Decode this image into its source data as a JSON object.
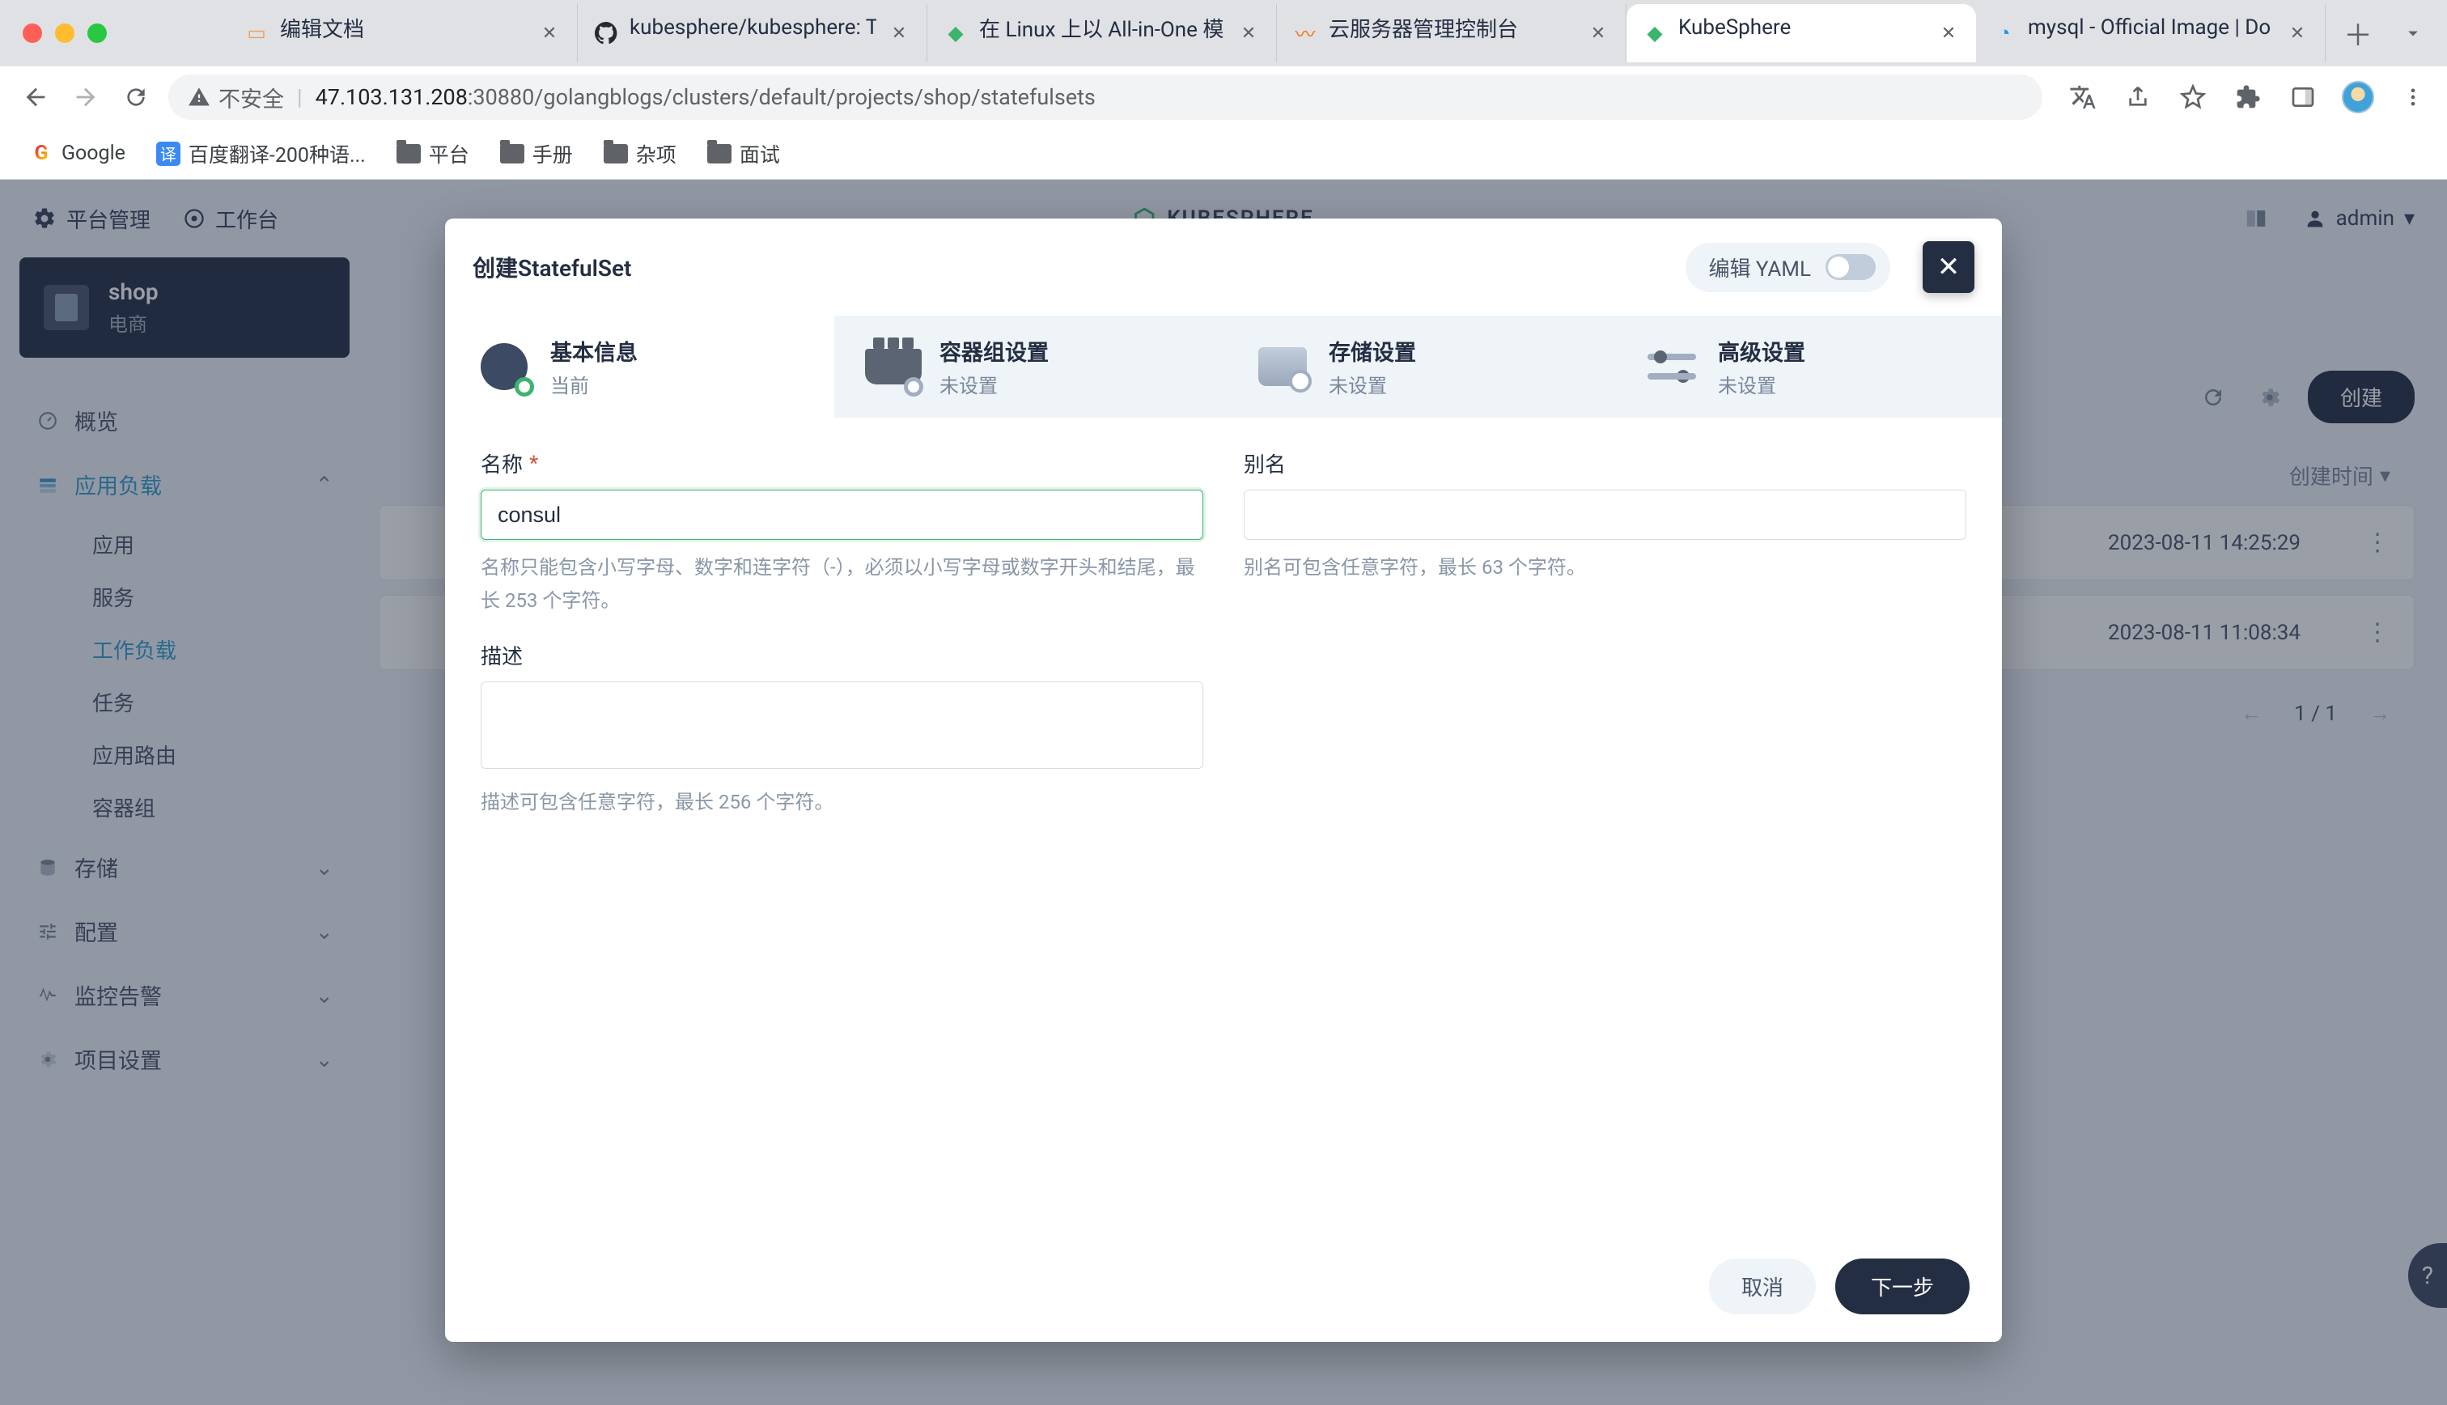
{
  "browser": {
    "tabs": [
      {
        "label": "编辑文档",
        "fav_color": "#f0a050",
        "fav_glyph": "▭"
      },
      {
        "label": "kubesphere/kubesphere: T",
        "fav_color": "#24292e",
        "fav_glyph": "◯"
      },
      {
        "label": "在 Linux 上以 All-in-One 模",
        "fav_color": "#3bb46e",
        "fav_glyph": "◆"
      },
      {
        "label": "云服务器管理控制台",
        "fav_color": "#ff6a00",
        "fav_glyph": "〰"
      },
      {
        "label": "KubeSphere",
        "fav_color": "#3bb46e",
        "fav_glyph": "◆",
        "active": true
      },
      {
        "label": "mysql - Official Image | Do",
        "fav_color": "#2496ed",
        "fav_glyph": "◔"
      }
    ],
    "security_label": "不安全",
    "url_host": "47.103.131.208",
    "url_rest": ":30880/golangblogs/clusters/default/projects/shop/statefulsets",
    "bookmarks": [
      {
        "label": "Google",
        "icon": "G",
        "color": "#4285f4"
      },
      {
        "label": "百度翻译-200种语...",
        "icon": "译",
        "color": "#3b8af2"
      },
      {
        "label": "平台",
        "folder": true
      },
      {
        "label": "手册",
        "folder": true
      },
      {
        "label": "杂项",
        "folder": true
      },
      {
        "label": "面试",
        "folder": true
      }
    ]
  },
  "header": {
    "platform": "平台管理",
    "workbench": "工作台",
    "brand": "KUBESPHERE",
    "user": "admin"
  },
  "project": {
    "name": "shop",
    "desc": "电商"
  },
  "sidebar": {
    "items": [
      {
        "label": "概览",
        "icon": "overview-icon"
      },
      {
        "label": "应用负载",
        "icon": "workload-icon",
        "expanded": true,
        "children": [
          {
            "label": "应用"
          },
          {
            "label": "服务"
          },
          {
            "label": "工作负载",
            "active": true
          },
          {
            "label": "任务"
          },
          {
            "label": "应用路由"
          },
          {
            "label": "容器组"
          }
        ]
      },
      {
        "label": "存储",
        "icon": "storage-icon",
        "expandable": true
      },
      {
        "label": "配置",
        "icon": "config-icon",
        "expandable": true
      },
      {
        "label": "监控告警",
        "icon": "monitor-icon",
        "expandable": true
      },
      {
        "label": "项目设置",
        "icon": "settings-icon",
        "expandable": true
      }
    ]
  },
  "toolbar": {
    "create": "创建",
    "refresh_icon": "refresh-icon",
    "gear_icon": "gear-icon"
  },
  "table": {
    "time_header": "创建时间",
    "rows": [
      {
        "time": "2023-08-11 14:25:29"
      },
      {
        "time": "2023-08-11 11:08:34"
      }
    ],
    "page": "1 / 1"
  },
  "modal": {
    "title": "创建StatefulSet",
    "yaml_label": "编辑 YAML",
    "steps": [
      {
        "title": "基本信息",
        "sub": "当前",
        "active": true,
        "icon": "info"
      },
      {
        "title": "容器组设置",
        "sub": "未设置",
        "icon": "ship"
      },
      {
        "title": "存储设置",
        "sub": "未设置",
        "icon": "disk"
      },
      {
        "title": "高级设置",
        "sub": "未设置",
        "icon": "slider"
      }
    ],
    "name_label": "名称",
    "name_value": "consul",
    "name_hint": "名称只能包含小写字母、数字和连字符（-），必须以小写字母或数字开头和结尾，最长 253 个字符。",
    "alias_label": "别名",
    "alias_hint": "别名可包含任意字符，最长 63 个字符。",
    "desc_label": "描述",
    "desc_hint": "描述可包含任意字符，最长 256 个字符。",
    "cancel": "取消",
    "next": "下一步"
  }
}
